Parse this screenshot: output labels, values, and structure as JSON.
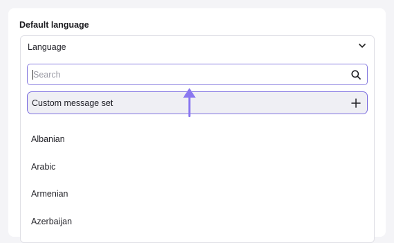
{
  "section": {
    "title": "Default language"
  },
  "dropdown": {
    "selected_label": "Language",
    "search": {
      "placeholder": "Search",
      "value": ""
    },
    "custom_option": {
      "label": "Custom message set"
    },
    "options": [
      "Albanian",
      "Arabic",
      "Armenian",
      "Azerbaijan"
    ]
  },
  "colors": {
    "accent": "#7d6fe0",
    "arrow": "#8a77f0",
    "custom_option_bg": "#efeff4",
    "page_bg": "#f4f4f7"
  },
  "icons": {
    "chevron": "chevron-down-icon",
    "search": "search-icon",
    "add": "plus-icon",
    "annotation": "up-arrow-icon"
  }
}
